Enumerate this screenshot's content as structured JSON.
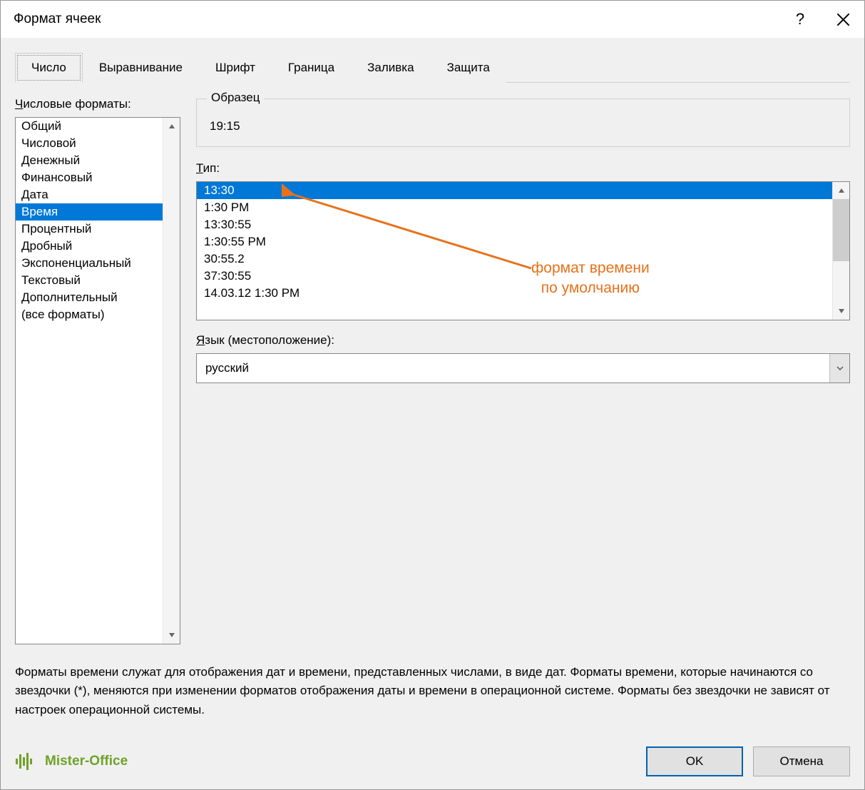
{
  "dialog": {
    "title": "Формат ячеек"
  },
  "tabs": {
    "items": [
      {
        "label": "Число"
      },
      {
        "label": "Выравнивание"
      },
      {
        "label": "Шрифт"
      },
      {
        "label": "Граница"
      },
      {
        "label": "Заливка"
      },
      {
        "label": "Защита"
      }
    ],
    "active_index": 0
  },
  "categories": {
    "label_u": "Ч",
    "label_rest": "исловые форматы:",
    "items": [
      "Общий",
      "Числовой",
      "Денежный",
      "Финансовый",
      "Дата",
      "Время",
      "Процентный",
      "Дробный",
      "Экспоненциальный",
      "Текстовый",
      "Дополнительный",
      "(все форматы)"
    ],
    "selected_index": 5
  },
  "sample": {
    "legend": "Образец",
    "value": "19:15"
  },
  "type": {
    "label_u": "Т",
    "label_rest": "ип:",
    "items": [
      "13:30",
      "1:30 PM",
      "13:30:55",
      "1:30:55 PM",
      "30:55.2",
      "37:30:55",
      "14.03.12 1:30 PM"
    ],
    "selected_index": 0
  },
  "locale": {
    "label_u": "Я",
    "label_rest": "зык (местоположение):",
    "value": "русский"
  },
  "annotation": {
    "line1": "формат времени",
    "line2": "по умолчанию",
    "color": "#e8711a"
  },
  "description": "Форматы времени служат для отображения дат и времени, представленных числами, в виде дат. Форматы времени, которые начинаются со звездочки (*), меняются при изменении форматов отображения даты и времени в операционной системе. Форматы без звездочки не зависят от настроек операционной системы.",
  "footer": {
    "brand": "Mister-Office",
    "ok": "OK",
    "cancel": "Отмена"
  }
}
